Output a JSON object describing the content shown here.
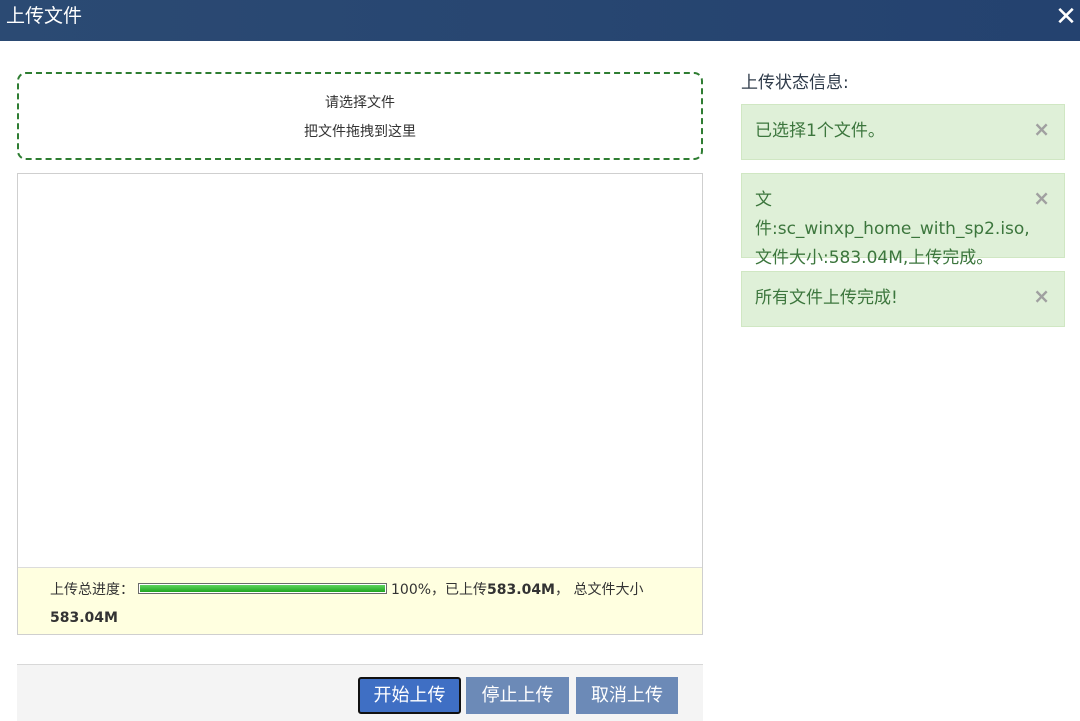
{
  "window": {
    "title": "上传文件",
    "close_icon": "close-icon"
  },
  "dropzone": {
    "line1": "请选择文件",
    "line2": "把文件拖拽到这里"
  },
  "progress": {
    "label": "上传总进度：",
    "percent_value": 100,
    "percent_text": "100%，",
    "uploaded_prefix": "已上传",
    "uploaded": "583.04M",
    "total_prefix": "， 总文件大小",
    "total": "583.04M"
  },
  "buttons": {
    "start": "开始上传",
    "stop": "停止上传",
    "cancel": "取消上传"
  },
  "status": {
    "title": "上传状态信息:",
    "messages": [
      {
        "line1": "已选择1个文件。"
      },
      {
        "line1": "文件:sc_winxp_home_with_sp2.iso,",
        "line2": "文件大小:583.04M,上传完成。"
      },
      {
        "line1": "所有文件上传完成!"
      }
    ],
    "dismiss": "×"
  },
  "colors": {
    "titlebar": "#2b4a73",
    "accent": "#3f6fc4",
    "success_bg": "#dff0d8",
    "success_text": "#3c763d",
    "progress": "#1fa61f"
  }
}
